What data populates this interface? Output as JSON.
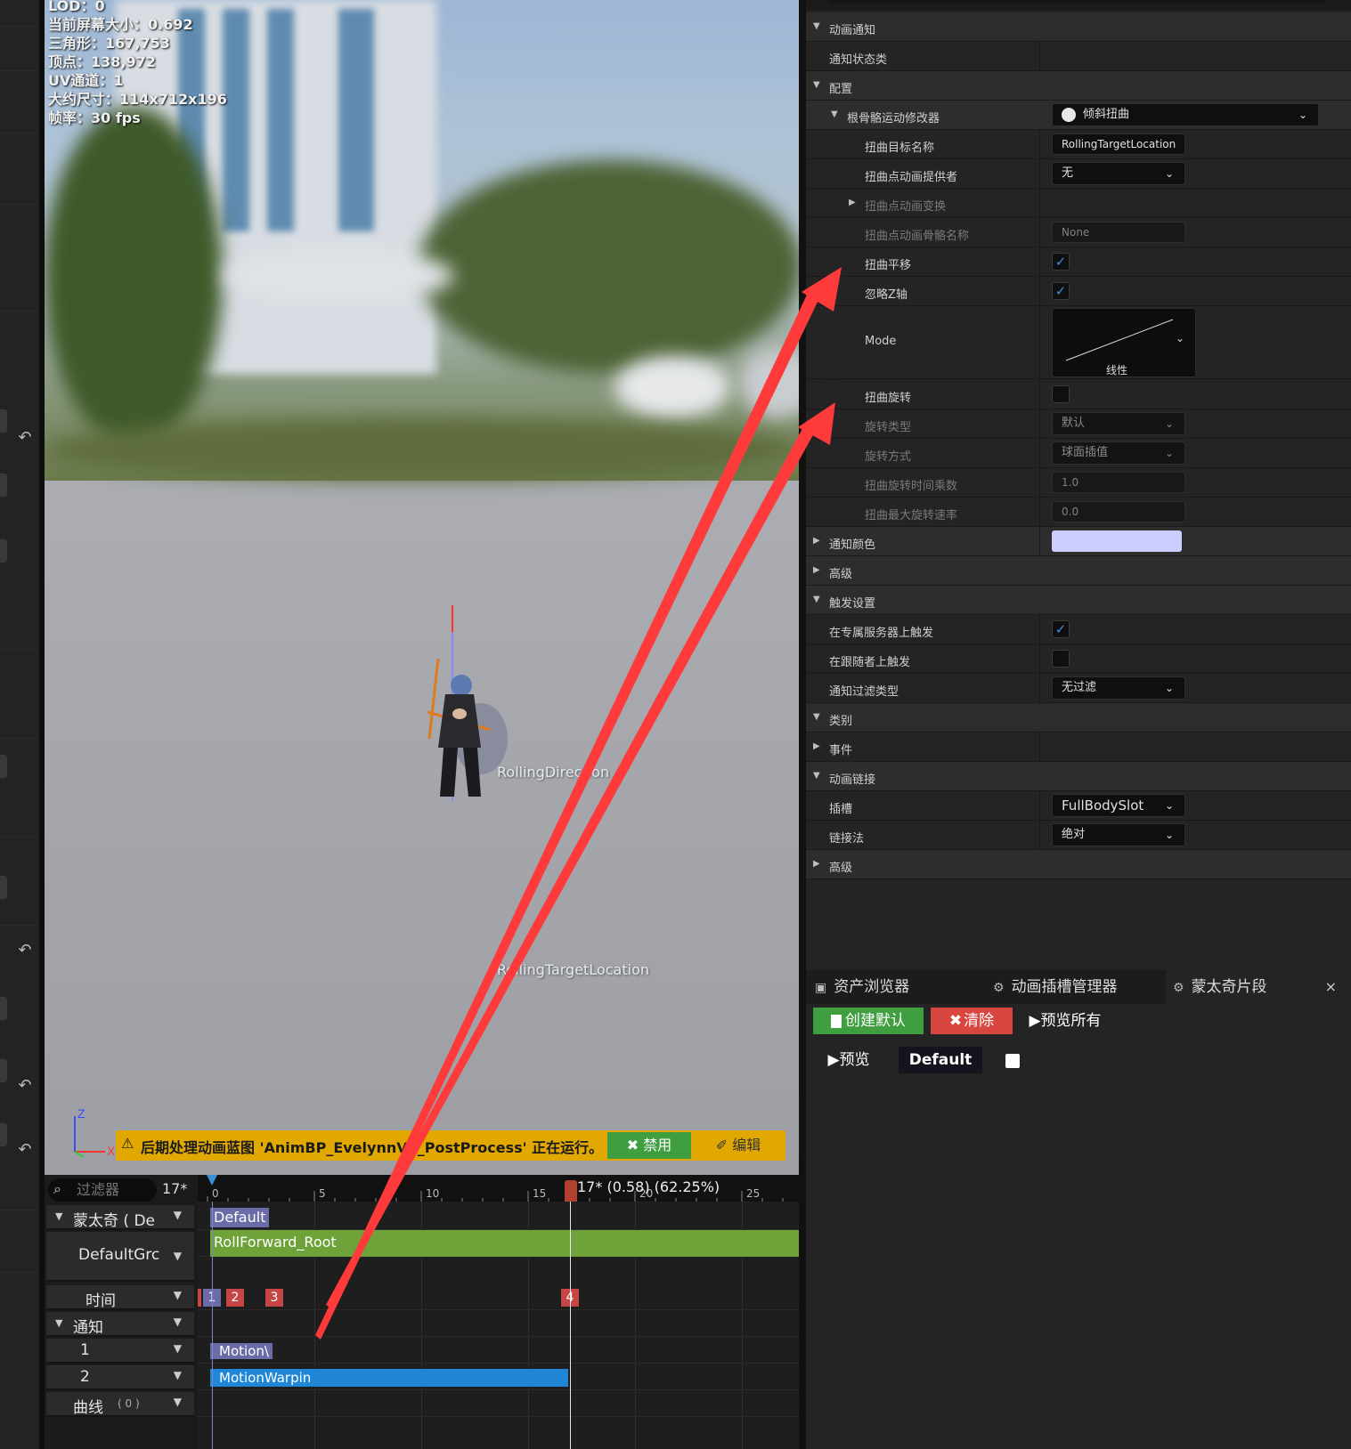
{
  "viewport": {
    "stats": [
      "LOD：0",
      "当前屏幕大小：0.692",
      "三角形：167,753",
      "顶点：138,972",
      "UV通道：1",
      "大约尺寸：114x712x196",
      "帧率：30 fps"
    ],
    "label_direction": "RollingDirection",
    "label_target": "RollingTargetLocation",
    "axis_z": "Z",
    "axis_x": "X",
    "notice": {
      "warn_icon": "⚠",
      "text": "后期处理动画蓝图 'AnimBP_EvelynnV4_PostProcess' 正在运行。",
      "disable": "✖ 禁用",
      "edit": "✐ 编辑"
    }
  },
  "timeline": {
    "search_placeholder": "过滤器",
    "frame_field": "17*",
    "current_time": "17* (0.58) (62.25%)",
    "ruler_labels": [
      "0",
      "5",
      "10",
      "15",
      "20",
      "25"
    ],
    "rows": {
      "montage": "蒙太奇 ( De",
      "group": "DefaultGrc",
      "time": "时间",
      "notifies": "通知",
      "track1": "1",
      "track2": "2",
      "curves": "曲线",
      "curves_count": "( 0 )"
    },
    "slot_label": "Default",
    "section_label": "RollForward_Root",
    "markers": [
      "1",
      "2",
      "3",
      "4"
    ],
    "notify1": "Motion\\",
    "notify2": "MotionWarpin"
  },
  "details": {
    "rows": [
      {
        "label": "动画通知"
      },
      {
        "label": "通知状态类"
      },
      {
        "label": "配置"
      },
      {
        "label": "根骨骼运动修改器",
        "value": "倾斜扭曲"
      },
      {
        "label": "扭曲目标名称",
        "value": "RollingTargetLocation"
      },
      {
        "label": "扭曲点动画提供者",
        "value": "无"
      },
      {
        "label": "扭曲点动画变换"
      },
      {
        "label": "扭曲点动画骨骼名称",
        "value": "None"
      },
      {
        "label": "扭曲平移"
      },
      {
        "label": "忽略Z轴"
      },
      {
        "label": "Mode",
        "value": "线性"
      },
      {
        "label": "扭曲旋转"
      },
      {
        "label": "旋转类型",
        "value": "默认"
      },
      {
        "label": "旋转方式",
        "value": "球面插值"
      },
      {
        "label": "扭曲旋转时间乘数",
        "value": "1.0"
      },
      {
        "label": "扭曲最大旋转速率",
        "value": "0.0"
      },
      {
        "label": "通知颜色"
      },
      {
        "label": "高级"
      },
      {
        "label": "触发设置"
      },
      {
        "label": "在专属服务器上触发"
      },
      {
        "label": "在跟随者上触发"
      },
      {
        "label": "通知过滤类型",
        "value": "无过滤"
      },
      {
        "label": "类别"
      },
      {
        "label": "事件"
      },
      {
        "label": "动画链接"
      },
      {
        "label": "插槽",
        "value": "FullBodySlot"
      },
      {
        "label": "链接法",
        "value": "绝对"
      },
      {
        "label": "高级"
      }
    ],
    "notify_color": "#ccccff"
  },
  "bottom": {
    "tabs": [
      "资产浏览器",
      "动画插槽管理器",
      "蒙太奇片段"
    ],
    "close": "×",
    "create_default": "创建默认",
    "clear": "清除",
    "preview_all": "预览所有",
    "preview": "预览",
    "default": "Default"
  },
  "colors": {
    "notice": "#e0a800",
    "green_button": "#3f9e3f",
    "red_button": "#d9453f",
    "section_bar": "#6fa33a",
    "notify_state": "#1f87d6",
    "annotation_arrow": "#ff3333",
    "checkbox_accent": "#3a8eea"
  }
}
